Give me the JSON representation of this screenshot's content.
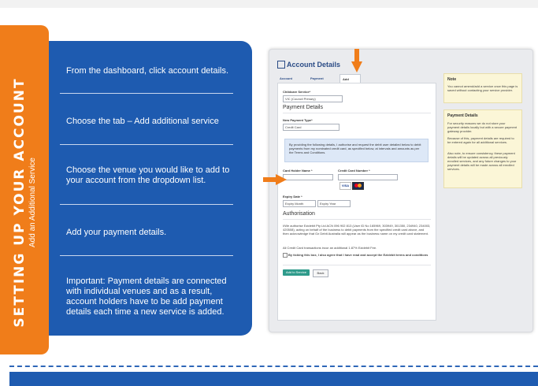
{
  "sidebar": {
    "title": "SETTING UP YOUR ACCOUNT",
    "subtitle": "Add an Additional Service"
  },
  "steps": [
    "From the dashboard, click account details.",
    "Choose the tab – Add additional service",
    "Choose the venue you would like to add to your account from the dropdown list.",
    "Add your payment details.",
    "Important: Payment details are connected with individual venues and as a result, account holders have to be add payment details each time a new service is added."
  ],
  "screenshot": {
    "title": "Account Details",
    "tabs": [
      "Account Details",
      "Payment Details",
      "Add additional service"
    ],
    "childcare_label": "Childcare Service*",
    "childcare_value": "VIC (Council Primary)",
    "payment_heading": "Payment Details",
    "payment_type_label": "New Payment Type*",
    "payment_type_value": "Credit Card",
    "info_text": "By providing the following details, I authorise and request the debit user detailed below to debit payments from my nominated credit card, as specified below, at intervals and amounts as per the Terms and Conditions.",
    "card_holder_label": "Card Holder Name *",
    "card_number_label": "Credit Card Number *",
    "card_visa": "VISA",
    "expiry_label": "Expiry Date *",
    "expiry_month": "Expiry Month",
    "expiry_year": "Expiry Year",
    "auth_heading": "Authorisation",
    "auth_text": "I/We authorise Ezidebit Pty Ltd ACN 096 902 813 (User ID No 165969, 303949, 301350, 234940, 234003, 420508), acting on behalf of the business to debit payments from the specified credit card above, and then acknowledge that Oz Debit Australia will appear as the business name on my credit card statement.",
    "fee_text": "All Credit Card transactions incur an additional 1.87% Ezidebit Fee.",
    "agree_text": "By ticking this box, I also agree that I have read and accept the Ezidebit terms and conditions",
    "submit_label": "Add to Service",
    "back_label": "Back",
    "note1_title": "Note",
    "note1_text": "You cannot amend/add a service once this page is saved without contacting your service provider.",
    "note2_title": "Payment Details",
    "note2_text1": "For security reasons we do not store your payment details locally but with a secure payment gateway provider.",
    "note2_text2": "Because of this, payment details are required to be entered again for all additional services.",
    "note2_text3": "Also note, to ensure consistency, these payment details will be updated across all previously enrolled services, and any future changes to your payment details will be made across all enrolled services."
  },
  "colors": {
    "orange": "#f07d1a",
    "blue": "#1e5bb0"
  },
  "icons": [
    "arrow-down-icon",
    "arrow-right-icon",
    "account-icon",
    "visa-icon",
    "mastercard-icon"
  ]
}
